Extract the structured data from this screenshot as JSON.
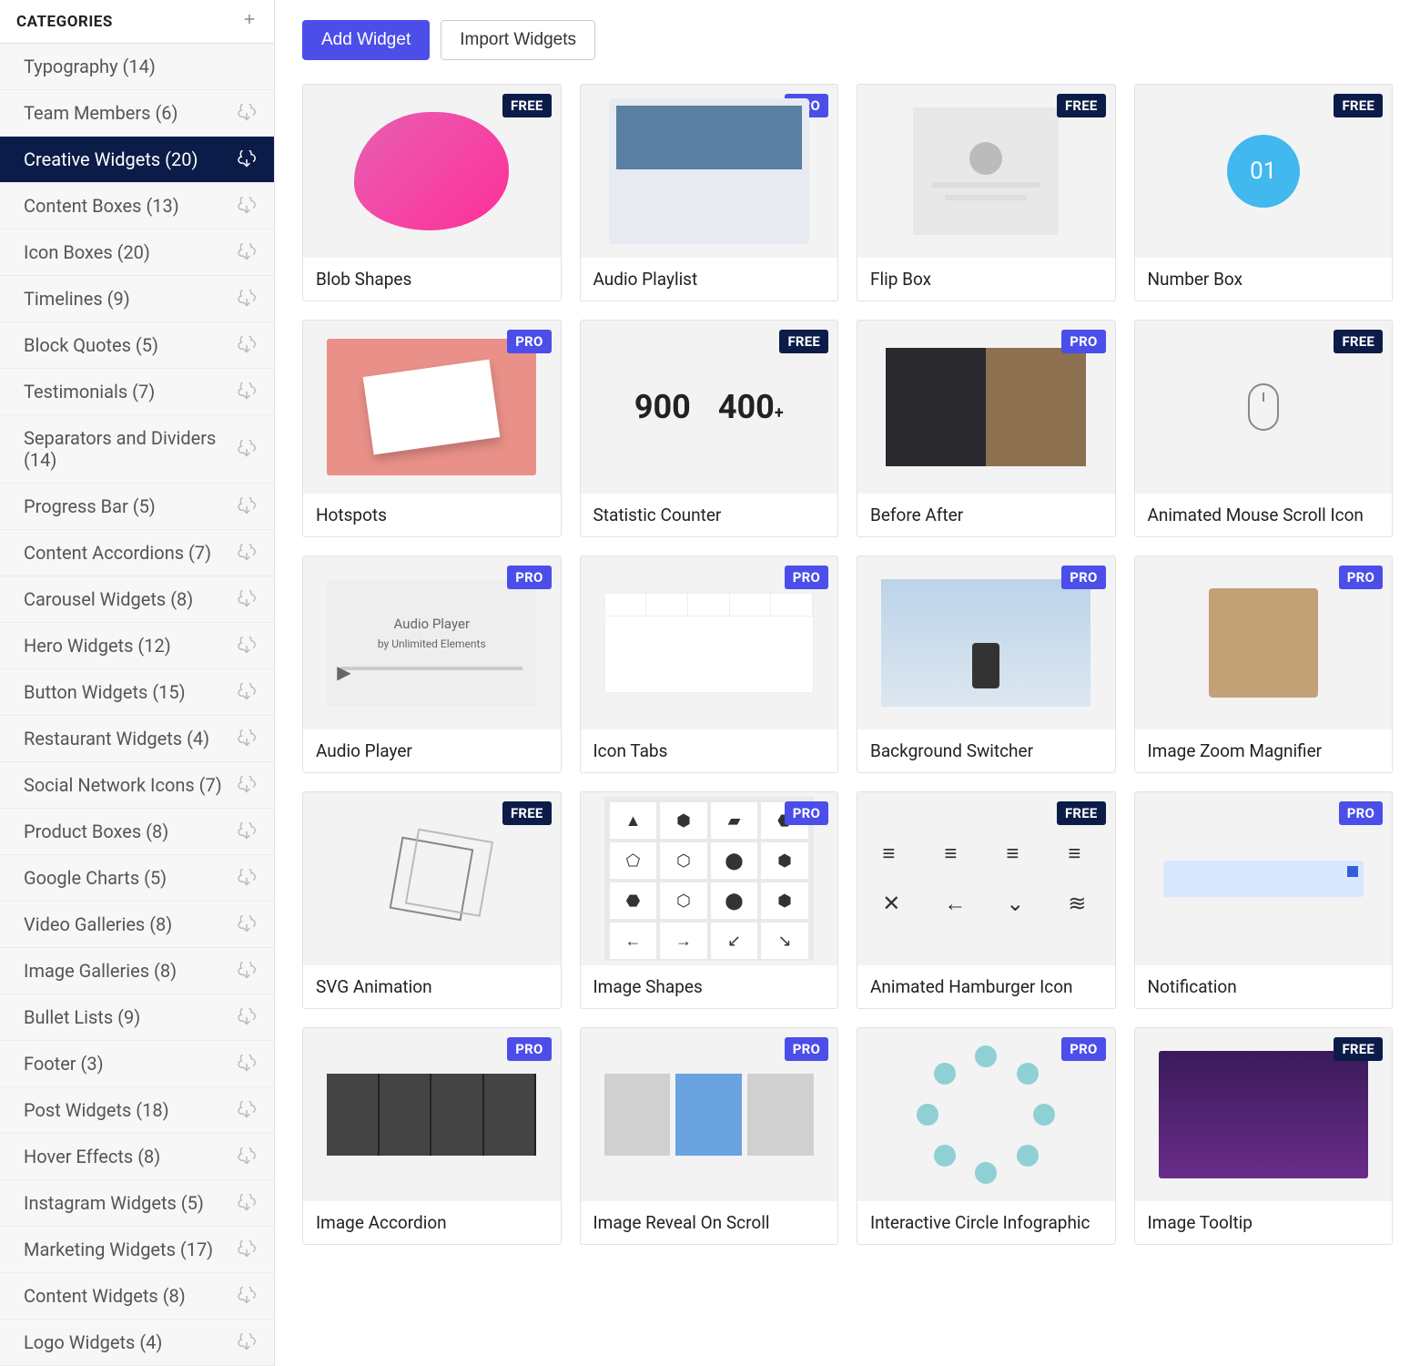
{
  "sidebar": {
    "title": "CATEGORIES",
    "categories": [
      {
        "label": "Typography (14)",
        "has_dl": false
      },
      {
        "label": "Team Members (6)",
        "has_dl": true
      },
      {
        "label": "Creative Widgets (20)",
        "has_dl": true,
        "active": true
      },
      {
        "label": "Content Boxes (13)",
        "has_dl": true
      },
      {
        "label": "Icon Boxes (20)",
        "has_dl": true
      },
      {
        "label": "Timelines (9)",
        "has_dl": true
      },
      {
        "label": "Block Quotes (5)",
        "has_dl": true
      },
      {
        "label": "Testimonials (7)",
        "has_dl": true
      },
      {
        "label": "Separators and Dividers (14)",
        "has_dl": true
      },
      {
        "label": "Progress Bar (5)",
        "has_dl": true
      },
      {
        "label": "Content Accordions (7)",
        "has_dl": true
      },
      {
        "label": "Carousel Widgets (8)",
        "has_dl": true
      },
      {
        "label": "Hero Widgets (12)",
        "has_dl": true
      },
      {
        "label": "Button Widgets (15)",
        "has_dl": true
      },
      {
        "label": "Restaurant Widgets (4)",
        "has_dl": true
      },
      {
        "label": "Social Network Icons (7)",
        "has_dl": true
      },
      {
        "label": "Product Boxes (8)",
        "has_dl": true
      },
      {
        "label": "Google Charts (5)",
        "has_dl": true
      },
      {
        "label": "Video Galleries (8)",
        "has_dl": true
      },
      {
        "label": "Image Galleries (8)",
        "has_dl": true
      },
      {
        "label": "Bullet Lists (9)",
        "has_dl": true
      },
      {
        "label": "Footer (3)",
        "has_dl": true
      },
      {
        "label": "Post Widgets (18)",
        "has_dl": true
      },
      {
        "label": "Hover Effects (8)",
        "has_dl": true
      },
      {
        "label": "Instagram Widgets (5)",
        "has_dl": true
      },
      {
        "label": "Marketing Widgets (17)",
        "has_dl": true
      },
      {
        "label": "Content Widgets (8)",
        "has_dl": true
      },
      {
        "label": "Logo Widgets (4)",
        "has_dl": true
      }
    ]
  },
  "toolbar": {
    "add_widget": "Add Widget",
    "import_widgets": "Import Widgets"
  },
  "widgets": [
    {
      "title": "Blob Shapes",
      "badge": "FREE",
      "thumb": "blob"
    },
    {
      "title": "Audio Playlist",
      "badge": "PRO",
      "thumb": "audio"
    },
    {
      "title": "Flip Box",
      "badge": "FREE",
      "thumb": "flip"
    },
    {
      "title": "Number Box",
      "badge": "FREE",
      "thumb": "number",
      "number_text": "01"
    },
    {
      "title": "Hotspots",
      "badge": "PRO",
      "thumb": "hotspot"
    },
    {
      "title": "Statistic Counter",
      "badge": "FREE",
      "thumb": "stat",
      "stat_a": "900",
      "stat_b": "400"
    },
    {
      "title": "Before After",
      "badge": "PRO",
      "thumb": "before"
    },
    {
      "title": "Animated Mouse Scroll Icon",
      "badge": "FREE",
      "thumb": "mouse"
    },
    {
      "title": "Audio Player",
      "badge": "PRO",
      "thumb": "player",
      "player_line1": "Audio Player",
      "player_line2": "by Unlimited Elements"
    },
    {
      "title": "Icon Tabs",
      "badge": "PRO",
      "thumb": "tabs"
    },
    {
      "title": "Background Switcher",
      "badge": "PRO",
      "thumb": "bg"
    },
    {
      "title": "Image Zoom Magnifier",
      "badge": "PRO",
      "thumb": "dog"
    },
    {
      "title": "SVG Animation",
      "badge": "FREE",
      "thumb": "cube"
    },
    {
      "title": "Image Shapes",
      "badge": "PRO",
      "thumb": "shapes"
    },
    {
      "title": "Animated Hamburger Icon",
      "badge": "FREE",
      "thumb": "hamburger"
    },
    {
      "title": "Notification",
      "badge": "PRO",
      "thumb": "notif"
    },
    {
      "title": "Image Accordion",
      "badge": "PRO",
      "thumb": "accordion"
    },
    {
      "title": "Image Reveal On Scroll",
      "badge": "PRO",
      "thumb": "reveal"
    },
    {
      "title": "Interactive Circle Infographic",
      "badge": "PRO",
      "thumb": "circle"
    },
    {
      "title": "Image Tooltip",
      "badge": "FREE",
      "thumb": "tooltip"
    }
  ]
}
